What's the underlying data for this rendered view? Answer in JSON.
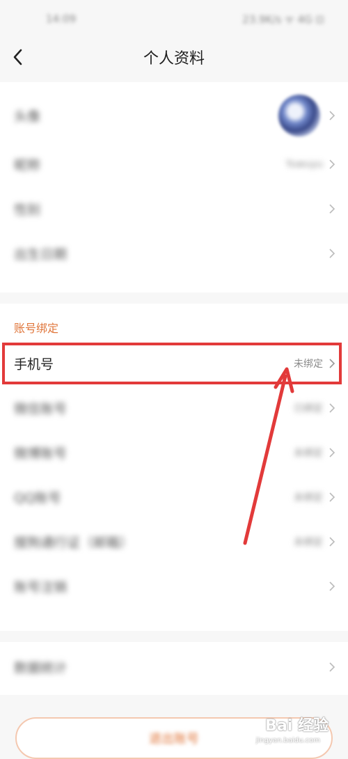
{
  "status_bar": {
    "time": "14:09",
    "icons": "23.9K/s ᯤ 4G ⊡"
  },
  "header": {
    "title": "个人资料"
  },
  "profile": {
    "items": [
      {
        "label": "头像",
        "value": ""
      },
      {
        "label": "昵称",
        "value": "Yuwuyu"
      },
      {
        "label": "性别",
        "value": ""
      },
      {
        "label": "出生日期",
        "value": ""
      }
    ]
  },
  "binding": {
    "section_title": "账号绑定",
    "items": [
      {
        "label": "手机号",
        "value": "未绑定"
      },
      {
        "label": "微信账号",
        "value": "已绑定"
      },
      {
        "label": "微博账号",
        "value": "未绑定"
      },
      {
        "label": "QQ账号",
        "value": "未绑定"
      },
      {
        "label": "搜狗通行证（邮箱）",
        "value": "未绑定"
      },
      {
        "label": "账号注销",
        "value": ""
      }
    ]
  },
  "stats": {
    "label": "数据统计"
  },
  "logout": {
    "label": "退出账号"
  },
  "watermark": {
    "text": "Bai 经验",
    "sub": "jingyan.baidu.com"
  },
  "colors": {
    "accent": "#e0763b",
    "highlight": "#e23a3a"
  }
}
